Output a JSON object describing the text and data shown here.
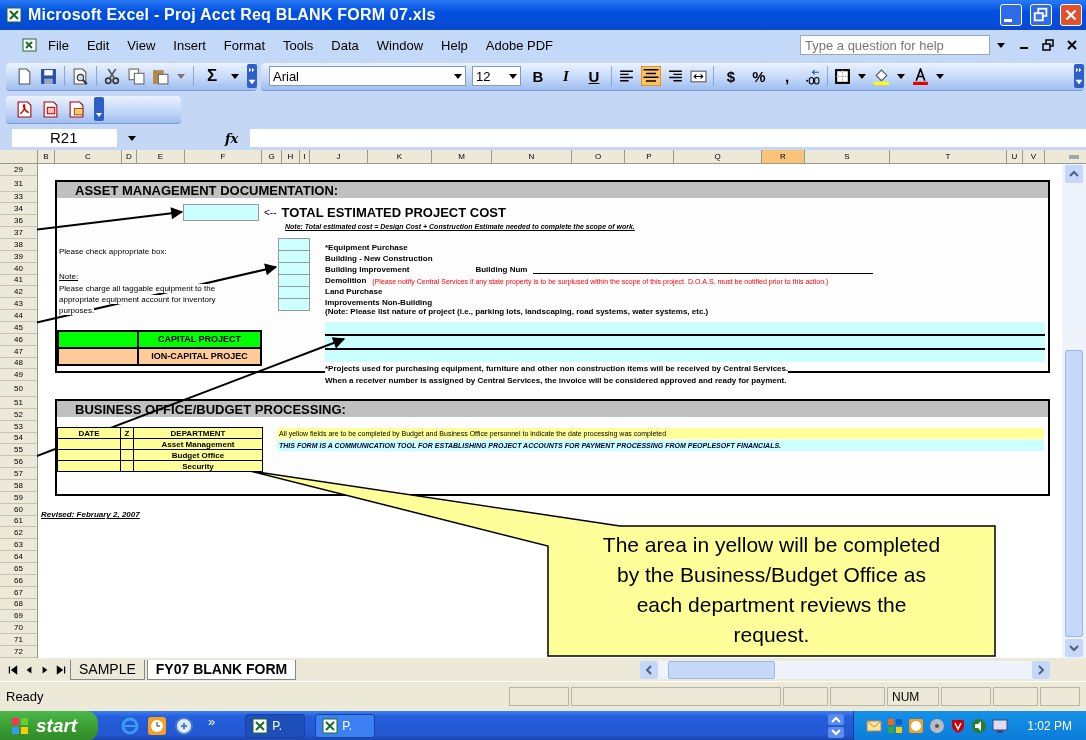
{
  "window": {
    "title": "Microsoft Excel - Proj Acct Req BLANK FORM 07.xls"
  },
  "menu": [
    "File",
    "Edit",
    "View",
    "Insert",
    "Format",
    "Tools",
    "Data",
    "Window",
    "Help",
    "Adobe PDF"
  ],
  "help_box": {
    "placeholder": "Type a question for help"
  },
  "toolbar": {
    "sum": "Σ",
    "font": "Arial",
    "size": "12",
    "styles": [
      "B",
      "I",
      "U"
    ],
    "align": [
      {
        "selected": false
      },
      {
        "selected": true
      },
      {
        "selected": false
      }
    ],
    "number": [
      "$",
      "%",
      ","
    ]
  },
  "formula_bar": {
    "name_box": "R21",
    "fx": "fx"
  },
  "columns": [
    {
      "label": "B",
      "selected": false
    },
    {
      "label": "C",
      "selected": false
    },
    {
      "label": "D",
      "selected": false
    },
    {
      "label": "E",
      "selected": false
    },
    {
      "label": "F",
      "selected": false
    },
    {
      "label": "G",
      "selected": false
    },
    {
      "label": "H",
      "selected": false
    },
    {
      "label": "I",
      "selected": false
    },
    {
      "label": "J",
      "selected": false
    },
    {
      "label": "K",
      "selected": false
    },
    {
      "label": "M",
      "selected": false
    },
    {
      "label": "N",
      "selected": false
    },
    {
      "label": "O",
      "selected": false
    },
    {
      "label": "P",
      "selected": false
    },
    {
      "label": "Q",
      "selected": false
    },
    {
      "label": "R",
      "selected": true
    },
    {
      "label": "S",
      "selected": false
    },
    {
      "label": "T",
      "selected": false
    },
    {
      "label": "U",
      "selected": false
    },
    {
      "label": "V",
      "selected": false
    }
  ],
  "rows": [
    "29",
    "31",
    "33",
    "34",
    "36",
    "37",
    "38",
    "39",
    "40",
    "41",
    "42",
    "43",
    "44",
    "45",
    "46",
    "47",
    "48",
    "49",
    "50",
    "51",
    "52",
    "53",
    "54",
    "55",
    "56",
    "57",
    "58",
    "59",
    "60",
    "61",
    "62",
    "63",
    "64",
    "65",
    "66",
    "67",
    "68",
    "69",
    "70",
    "71",
    "72"
  ],
  "asset_section": {
    "title": "ASSET MANAGEMENT DOCUMENTATION:",
    "pointer": "<--",
    "total_label": "TOTAL ESTIMATED PROJECT COST",
    "note": "Note: Total estimated cost = Design Cost + Construction Estimate needed to complete the scope of work.",
    "instruction": "Please check appropriate box:",
    "note_heading": "Note:",
    "note_text": "Please charge all taggable equipment to the appropriate equipment account for inventory purposes.",
    "options": [
      {
        "label": "*Equipment Purchase",
        "checked": false
      },
      {
        "label": "Building - New Construction",
        "checked": false
      },
      {
        "label": "Building Improvement",
        "checked": false,
        "field_label": "Building Num"
      },
      {
        "label": "Demolition",
        "checked": false,
        "remark": "(Please notify Central Services if any state property is to be surplused within the scope of this project.  D.O.A.S. must be notified prior to this action.)"
      },
      {
        "label": "Land Purchase",
        "checked": false
      },
      {
        "label": "Improvements Non-Building",
        "checked": false
      }
    ],
    "nature_note": "(Note:  Please list nature of project (i.e., parking lots, landscaping, road systems, water systems, etc.)",
    "footnotes": [
      "*Projects used for purchasing equipment, furniture and other non construction items will be received by Central Services.",
      "When a receiver number is assigned by Central Services, the invoice will be considered approved and ready for payment."
    ],
    "project_types": [
      {
        "label": "CAPITAL PROJECT",
        "color": "#00ff00"
      },
      {
        "label": "ION-CAPITAL PROJEC",
        "color": "#ffcc99"
      }
    ]
  },
  "business_section": {
    "title": "BUSINESS OFFICE/BUDGET PROCESSING:",
    "table": {
      "columns": [
        "DATE",
        "Z",
        "DEPARTMENT"
      ],
      "rows": [
        "Asset Management",
        "Budget Office",
        "Security"
      ]
    },
    "notes": [
      {
        "kind": "plain",
        "text": "All yellow fields are to be completed by Budget and Business Office personnel to indicate the date processing was completed",
        "color": "#ffff99"
      },
      {
        "kind": "emphasis",
        "text": "THIS FORM IS A COMMUNICATION TOOL FOR ESTABLISHING PROJECT ACCOUNTS FOR PAYMENT PROCESSING FROM PEOPLESOFT FINANCIALS.",
        "color": "#ccffff"
      }
    ]
  },
  "revised": "Revised: February 2, 2007",
  "callout": {
    "lines": [
      "The area in yellow will be completed",
      "by the Business/Budget Office as",
      "each department reviews the",
      "request."
    ]
  },
  "sheet_tabs": [
    {
      "label": "SAMPLE",
      "selected": false
    },
    {
      "label": "FY07 BLANK FORM",
      "selected": true
    }
  ],
  "status_bar": {
    "text": "Ready",
    "indicator": "NUM"
  },
  "taskbar": {
    "start": "start",
    "more": "»",
    "tasks": [
      "P.",
      "P."
    ],
    "clock": "1:02 PM"
  }
}
